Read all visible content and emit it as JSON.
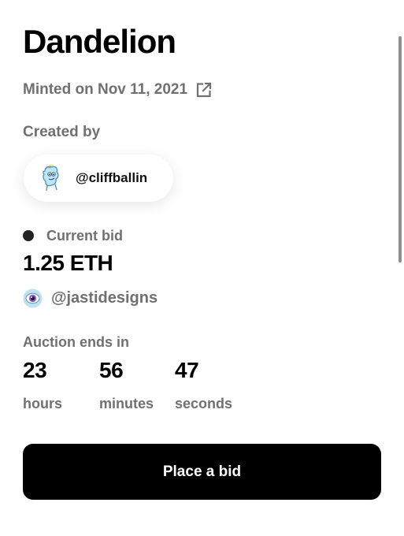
{
  "artwork": {
    "title": "Dandelion",
    "minted_text": "Minted on Nov 11, 2021",
    "external_link_icon": "external-link-icon"
  },
  "creator": {
    "label": "Created by",
    "handle": "@cliffballin",
    "avatar_icon": "creator-avatar-illustration"
  },
  "bid": {
    "status_label": "Current bid",
    "amount": "1.25 ETH",
    "bidder_handle": "@jastidesigns",
    "bidder_avatar_icon": "eye-avatar",
    "status_dot_color": "#222222"
  },
  "auction": {
    "label": "Auction ends in",
    "hours_value": "23",
    "hours_unit": "hours",
    "minutes_value": "56",
    "minutes_unit": "minutes",
    "seconds_value": "47",
    "seconds_unit": "seconds"
  },
  "actions": {
    "place_bid_label": "Place a bid",
    "button_color": "#000000"
  },
  "colors": {
    "text_primary": "#000000",
    "text_secondary": "#707070",
    "background": "#ffffff"
  }
}
